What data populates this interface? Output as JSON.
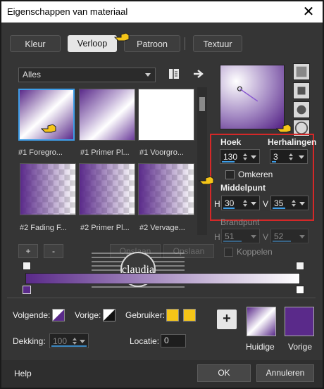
{
  "window": {
    "title": "Eigenschappen van materiaal",
    "close_glyph": "✕"
  },
  "tabs": [
    {
      "label": "Kleur"
    },
    {
      "label": "Verloop"
    },
    {
      "label": "Patroon"
    },
    {
      "label": "Textuur"
    }
  ],
  "category": {
    "value": "Alles"
  },
  "gradients": [
    {
      "caption": "#1 Foregro..."
    },
    {
      "caption": "#1 Primer Pl..."
    },
    {
      "caption": "#1 Voorgro..."
    },
    {
      "caption": "#2 Fading F..."
    },
    {
      "caption": "#2 Primer Pl..."
    },
    {
      "caption": "#2 Vervage..."
    }
  ],
  "settings": {
    "angle_label": "Hoek",
    "angle_value": "130",
    "repeats_label": "Herhalingen",
    "repeats_value": "3",
    "invert_label": "Omkeren",
    "centerpoint_label": "Middelpunt",
    "center_h_label": "H",
    "center_h_value": "30",
    "center_v_label": "V",
    "center_v_value": "35",
    "focal_label": "Brandpunt",
    "focal_h_label": "H",
    "focal_h_value": "51",
    "focal_v_label": "V",
    "focal_v_value": "52",
    "link_label": "Koppelen"
  },
  "editor": {
    "add_label": "+",
    "remove_label": "-",
    "ghost1_label": "Opslaan",
    "ghost2_label": "Opslaan"
  },
  "watermark": {
    "text": "claudia",
    "subtext": "art & more"
  },
  "lower": {
    "next_label": "Volgende:",
    "prev_label": "Vorige:",
    "user_label": "Gebruiker:",
    "opacity_label": "Dekking:",
    "opacity_value": "100",
    "location_label": "Locatie:",
    "location_value": "0",
    "current_label": "Huidige",
    "previous_label": "Vorige"
  },
  "footer": {
    "help_label": "Help",
    "ok_label": "OK",
    "cancel_label": "Annuleren"
  },
  "colors": {
    "purple": "#5a2a8a",
    "white": "#ffffff",
    "yellow": "#f5c518",
    "accent": "#3e9ee8",
    "red_highlight": "#d42828"
  }
}
